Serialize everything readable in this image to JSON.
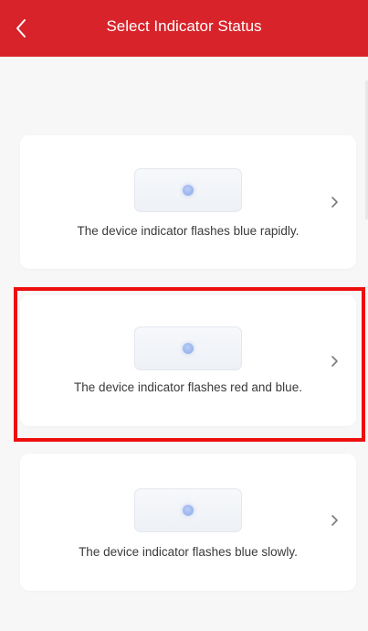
{
  "header": {
    "title": "Select Indicator Status",
    "back_icon": "chevron-left-icon",
    "background_color": "#d8232a"
  },
  "options": [
    {
      "label": "The device indicator flashes blue rapidly.",
      "indicator_color": "#98b3ec",
      "arrow_icon": "chevron-right-icon"
    },
    {
      "label": "The device indicator flashes red and blue.",
      "indicator_color": "#98b3ec",
      "arrow_icon": "chevron-right-icon",
      "highlighted": true
    },
    {
      "label": "The device indicator flashes blue slowly.",
      "indicator_color": "#98b3ec",
      "arrow_icon": "chevron-right-icon"
    }
  ],
  "highlight_color": "#ee0e0e"
}
